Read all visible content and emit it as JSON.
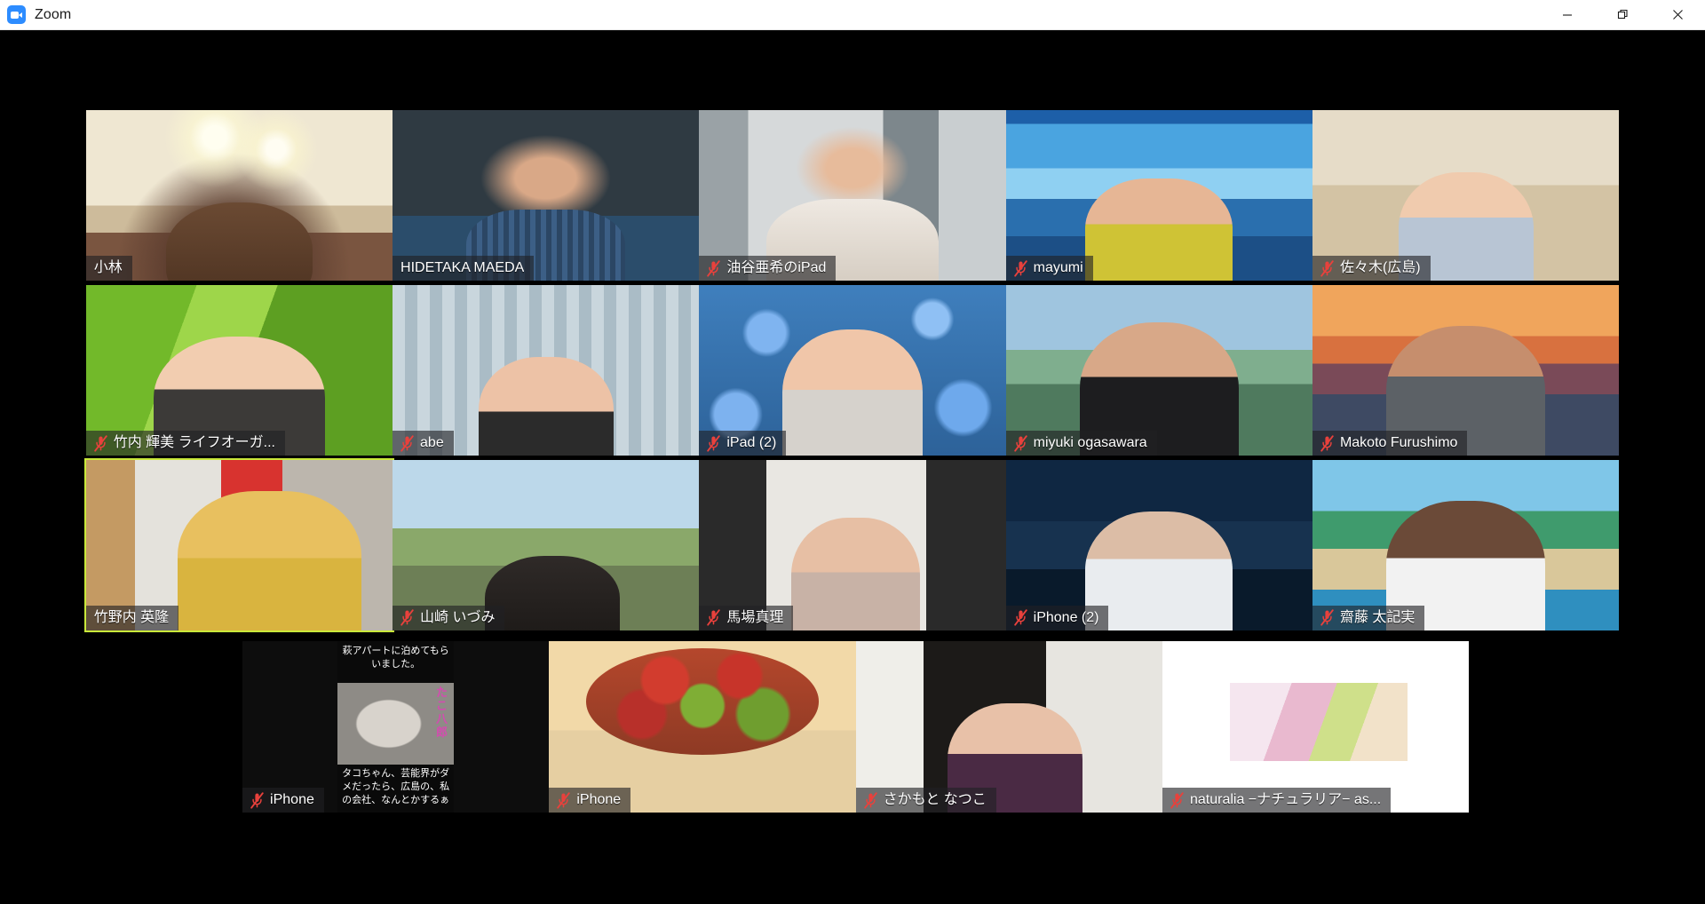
{
  "window": {
    "app_name": "Zoom",
    "icon": "zoom-camera-icon",
    "controls": {
      "minimize": "minimize-icon",
      "maximize": "restore-icon",
      "close": "close-icon"
    }
  },
  "gallery": {
    "layout": "gallery-view",
    "columns": 5,
    "rows": 4,
    "active_speaker_color": "#c9e83a",
    "mute_icon_color": "#e8413c",
    "background_color": "#000000",
    "participants": [
      {
        "name": "小林",
        "muted": false,
        "active_speaker": false,
        "row": 1,
        "col": 1,
        "bg": "bg-room1"
      },
      {
        "name": "HIDETAKA MAEDA",
        "muted": false,
        "active_speaker": false,
        "row": 1,
        "col": 2,
        "bg": "bg-dark1"
      },
      {
        "name": "油谷亜希のiPad",
        "muted": true,
        "active_speaker": false,
        "row": 1,
        "col": 3,
        "bg": "bg-window"
      },
      {
        "name": "mayumi",
        "muted": true,
        "active_speaker": false,
        "row": 1,
        "col": 4,
        "bg": "bg-sea"
      },
      {
        "name": "佐々木(広島)",
        "muted": true,
        "active_speaker": false,
        "row": 1,
        "col": 5,
        "bg": "bg-tatami"
      },
      {
        "name": "竹内 輝美 ライフオーガ...",
        "muted": true,
        "active_speaker": false,
        "row": 2,
        "col": 1,
        "bg": "bg-grass"
      },
      {
        "name": "abe",
        "muted": true,
        "active_speaker": false,
        "row": 2,
        "col": 2,
        "bg": "bg-curtain"
      },
      {
        "name": "iPad (2)",
        "muted": true,
        "active_speaker": false,
        "row": 2,
        "col": 3,
        "bg": "bg-flowers"
      },
      {
        "name": "miyuki ogasawara",
        "muted": true,
        "active_speaker": false,
        "row": 2,
        "col": 4,
        "bg": "bg-torii"
      },
      {
        "name": "Makoto Furushimo",
        "muted": true,
        "active_speaker": false,
        "row": 2,
        "col": 5,
        "bg": "bg-bridge"
      },
      {
        "name": "竹野内 英隆",
        "muted": false,
        "active_speaker": true,
        "row": 3,
        "col": 1,
        "bg": "bg-shop"
      },
      {
        "name": "山崎 いづみ",
        "muted": true,
        "active_speaker": false,
        "row": 3,
        "col": 2,
        "bg": "bg-sakura"
      },
      {
        "name": "馬場真理",
        "muted": true,
        "active_speaker": false,
        "row": 3,
        "col": 3,
        "bg": "bg-blinds"
      },
      {
        "name": "iPhone (2)",
        "muted": true,
        "active_speaker": false,
        "row": 3,
        "col": 4,
        "bg": "bg-gate"
      },
      {
        "name": "齋藤 太記実",
        "muted": true,
        "active_speaker": false,
        "row": 3,
        "col": 5,
        "bg": "bg-beach"
      },
      {
        "name": "iPhone",
        "muted": true,
        "active_speaker": false,
        "row": 4,
        "col": 1,
        "bg": "bg-tako"
      },
      {
        "name": "iPhone",
        "muted": true,
        "active_speaker": false,
        "row": 4,
        "col": 2,
        "bg": "bg-bouquet"
      },
      {
        "name": "さかもと なつこ",
        "muted": true,
        "active_speaker": false,
        "row": 4,
        "col": 3,
        "bg": "bg-door"
      },
      {
        "name": "naturalia −ナチュラリア− as...",
        "muted": true,
        "active_speaker": false,
        "row": 4,
        "col": 4,
        "bg": "bg-product"
      }
    ]
  },
  "shared_screen_text": {
    "top_line_1": "萩アパートに泊めてもら",
    "top_line_2": "いました。",
    "side_caption": "たこ八郎",
    "bottom_line_1": "タコちゃん、芸能界がダ",
    "bottom_line_2": "メだったら、広島の、私",
    "bottom_line_3": "の会社、なんとかするぁ"
  }
}
